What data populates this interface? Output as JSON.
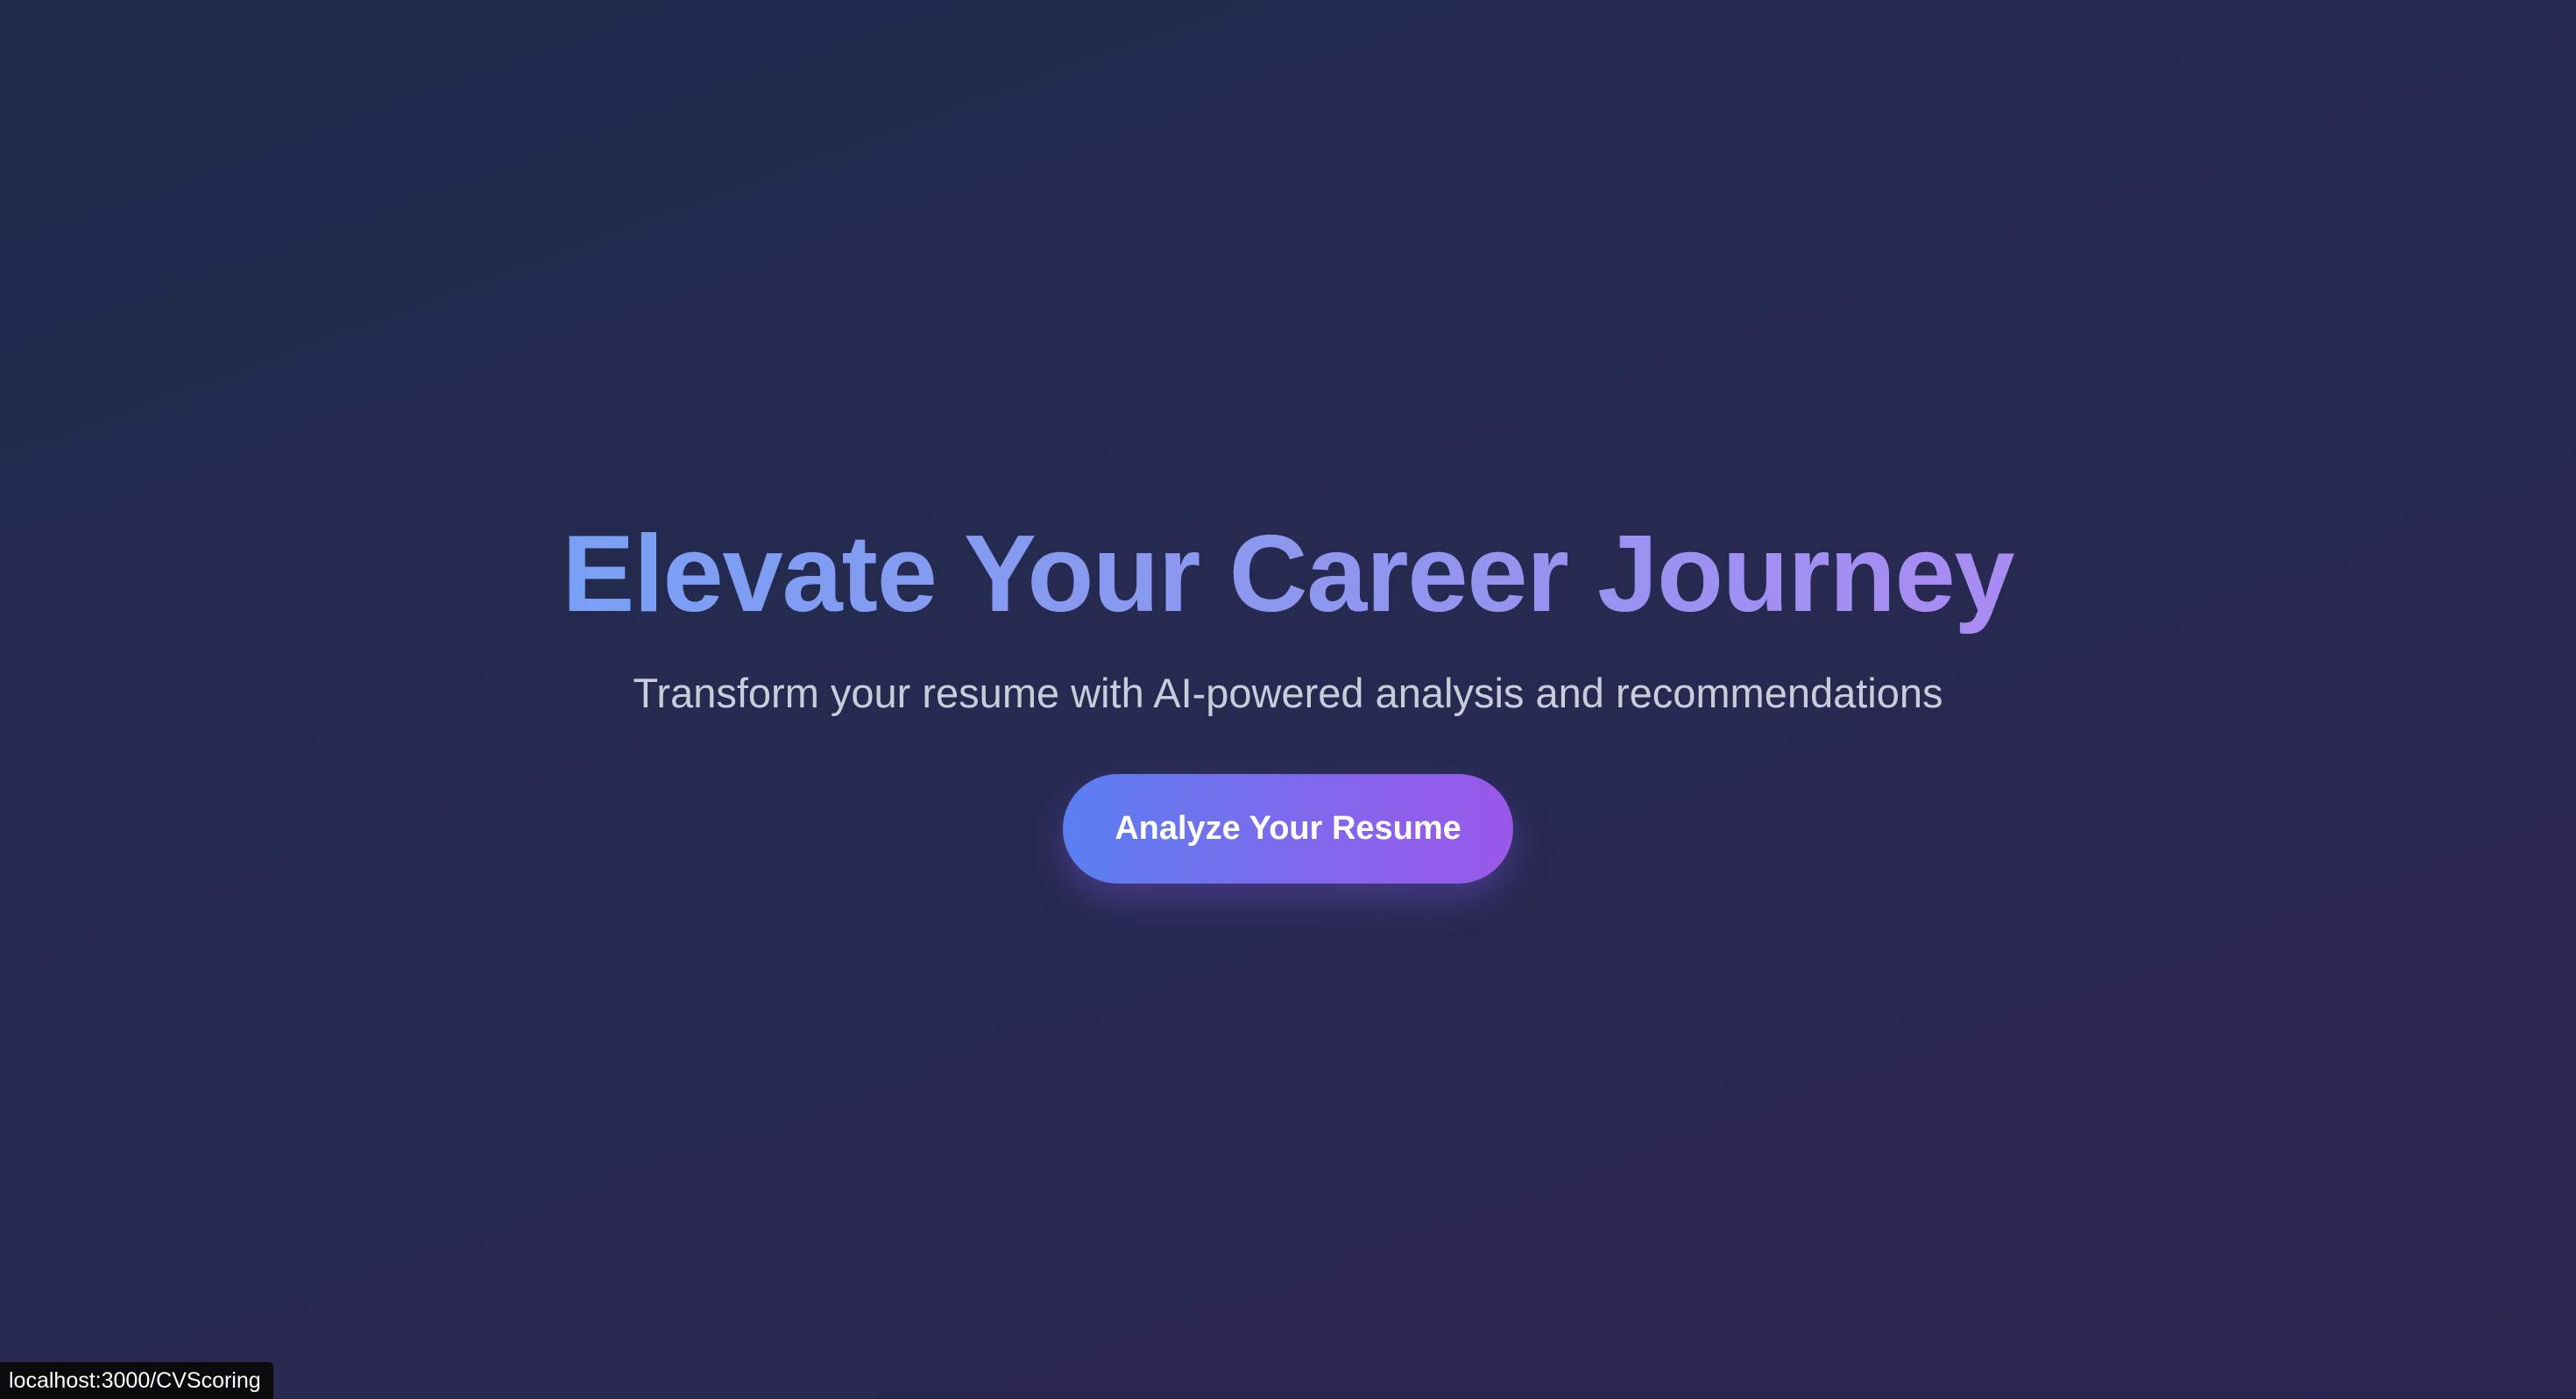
{
  "hero": {
    "title": "Elevate Your Career Journey",
    "subtitle": "Transform your resume with AI-powered analysis and recommendations",
    "cta_label": "Analyze Your Resume"
  },
  "status_bar": {
    "url": "localhost:3000/CVScoring"
  },
  "colors": {
    "background_start": "#1f2a4a",
    "background_end": "#2b2550",
    "title_gradient_start": "#7aa0f5",
    "title_gradient_end": "#a98bf2",
    "button_gradient_start": "#5a7ff0",
    "button_gradient_end": "#9a58e8",
    "subtitle_text": "#c9ccd9"
  }
}
